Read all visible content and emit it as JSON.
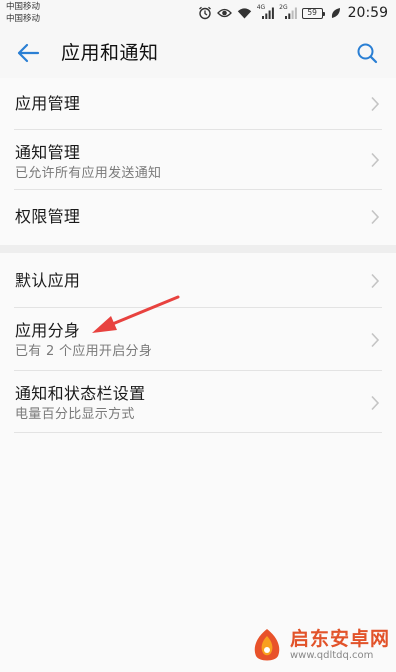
{
  "status_bar": {
    "carrier_1": "中国移动",
    "carrier_2": "中国移动",
    "net_1": "4G",
    "net_2": "2G",
    "battery": "59",
    "time": "20:59"
  },
  "header": {
    "title": "应用和通知"
  },
  "section_1": {
    "items": [
      {
        "title": "应用管理",
        "subtitle": ""
      },
      {
        "title": "通知管理",
        "subtitle": "已允许所有应用发送通知"
      },
      {
        "title": "权限管理",
        "subtitle": ""
      }
    ]
  },
  "section_2": {
    "items": [
      {
        "title": "默认应用",
        "subtitle": ""
      },
      {
        "title": "应用分身",
        "subtitle": "已有 2 个应用开启分身"
      },
      {
        "title": "通知和状态栏设置",
        "subtitle": "电量百分比显示方式"
      }
    ]
  },
  "watermark": {
    "name": "启东安卓网",
    "url": "www.qdltdq.com"
  },
  "colors": {
    "accent": "#2a7fd4",
    "annotation_arrow": "#e8423f",
    "watermark": "#e2532a"
  }
}
